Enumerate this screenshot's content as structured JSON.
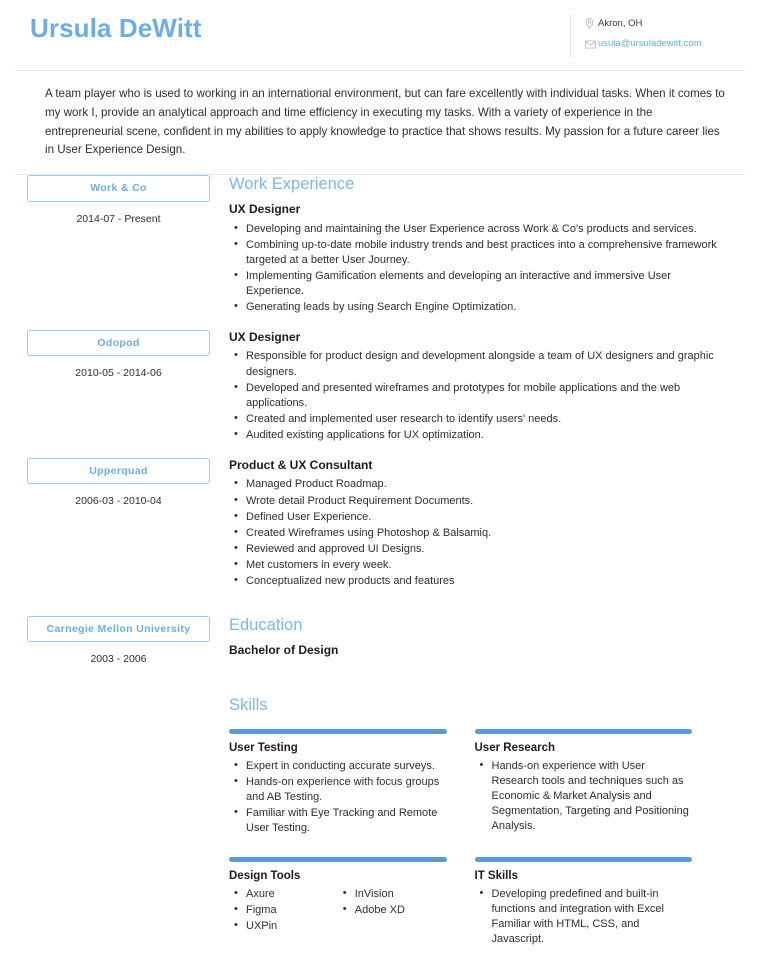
{
  "header": {
    "full_name": "Ursula DeWitt",
    "contacts": [
      {
        "icon": "map-pin-icon",
        "text": "Akron, OH",
        "is_link": false
      },
      {
        "icon": "envelope-icon",
        "text": "usula@ursuladewitt.com",
        "is_link": true
      }
    ]
  },
  "summary": {
    "text": "A team player who is used to working in an international environment, but can fare excellently with individual tasks. When it comes to my work I, provide an analytical approach and time efficiency in executing my tasks. With a variety of experience in the entrepreneurial scene, confident in my abilities to apply knowledge to practice that shows results. My passion for a future career lies in User Experience Design."
  },
  "work_experience": {
    "title": "Work Experience",
    "entries": [
      {
        "company": "Work & Co",
        "dates": "2014-07 - Present",
        "role": "UX Designer",
        "bullets": [
          "Developing and maintaining the User Experience across Work & Co's products and services.",
          "Combining up-to-date mobile industry trends and best practices into a comprehensive framework targeted at a better User Journey.",
          "Implementing Gamification elements and developing an interactive and immersive User Experience.",
          "Generating leads by using Search Engine Optimization."
        ]
      },
      {
        "company": "Odopod",
        "dates": "2010-05 - 2014-06",
        "role": "UX Designer",
        "bullets": [
          "Responsible for product design and development alongside a team of UX designers and graphic designers.",
          "Developed and presented wireframes and prototypes for mobile applications and the web applications.",
          "Created and implemented user research to identify users' needs.",
          "Audited existing applications for UX optimization."
        ]
      },
      {
        "company": "Upperquad",
        "dates": "2006-03 - 2010-04",
        "role": "Product & UX Consultant",
        "bullets": [
          "Managed Product Roadmap.",
          "Wrote detail Product Requirement Documents.",
          "Defined User Experience.",
          "Created Wireframes using Photoshop & Balsamiq.",
          "Reviewed and approved UI Designs.",
          "Met customers in every week.",
          "Conceptualized new products and features"
        ]
      }
    ]
  },
  "education": {
    "title": "Education",
    "entries": [
      {
        "school": "Carnegie Mellon University",
        "dates": "2003 - 2006",
        "degree": "Bachelor of Design"
      }
    ]
  },
  "skills": {
    "title": "Skills",
    "groups": [
      {
        "name": "User Testing",
        "columns": [
          [
            "Expert in conducting accurate surveys.",
            "Hands-on experience with focus groups and AB Testing.",
            "Familiar with Eye Tracking and Remote User Testing."
          ]
        ]
      },
      {
        "name": "User Research",
        "columns": [
          [
            "Hands-on experience with User Research tools and techniques such as Economic & Market Analysis and Segmentation, Targeting and Positioning Analysis."
          ]
        ]
      },
      {
        "name": "Design Tools",
        "columns": [
          [
            "Axure",
            "Figma",
            "UXPin"
          ],
          [
            "InVision",
            "Adobe XD"
          ]
        ]
      },
      {
        "name": "IT Skills",
        "columns": [
          [
            "Developing predefined and built-in functions and integration with Excel Familiar with HTML, CSS, and Javascript."
          ]
        ]
      }
    ]
  },
  "colors": {
    "accent": "#6cade6",
    "heading": "#7cb8ea",
    "skill_bar": "#5b9bd5",
    "badge_border": "#9ccbf0",
    "rule": "#e6e6e6"
  }
}
